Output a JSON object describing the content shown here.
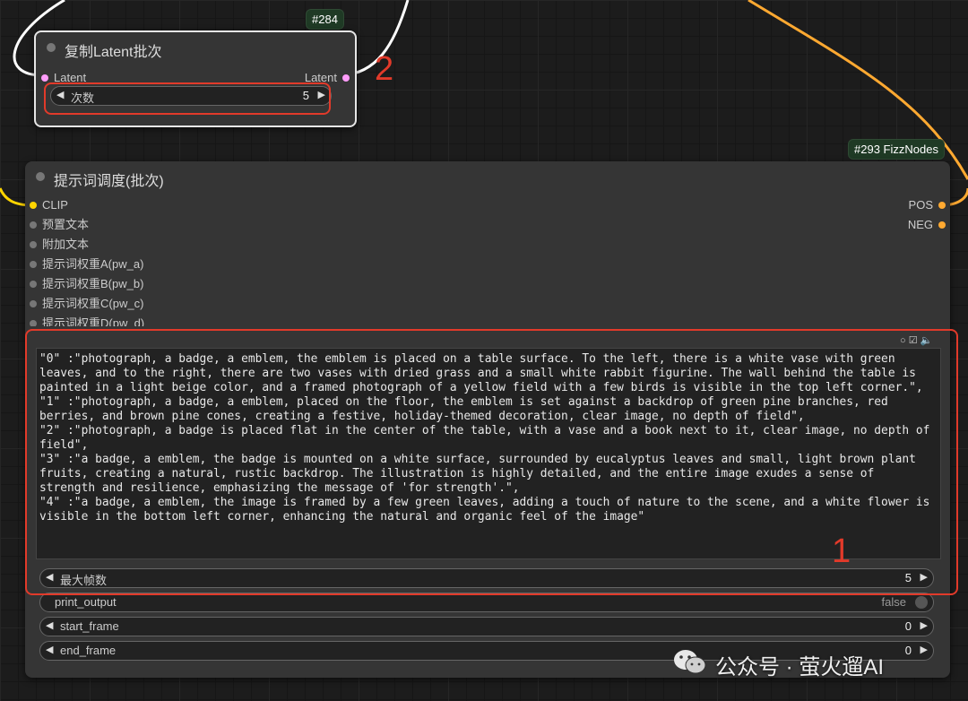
{
  "colors": {
    "annotation": "#e23a2a",
    "latent_pin": "#ff9cf9",
    "clip_pin": "#ffd500",
    "conditioning_pin": "#ffa931",
    "wire_orange": "#ffa931",
    "node_bg": "#353535",
    "badge_bg": "#1f3a25"
  },
  "node_latent": {
    "id": "#284",
    "title": "复制Latent批次",
    "input_label": "Latent",
    "output_label": "Latent",
    "widget": {
      "label": "次数",
      "value": "5"
    }
  },
  "node_prompt": {
    "id": "#293 FizzNodes",
    "title": "提示词调度(批次)",
    "inputs": [
      "CLIP",
      "预置文本",
      "附加文本",
      "提示词权重A(pw_a)",
      "提示词权重B(pw_b)",
      "提示词权重C(pw_c)",
      "提示词权重D(pw_d)"
    ],
    "outputs": [
      "POS",
      "NEG"
    ],
    "text": "\"0\" :\"photograph, a badge, a emblem, the emblem is placed on a table surface. To the left, there is a white vase with green leaves, and to the right, there are two vases with dried grass and a small white rabbit figurine. The wall behind the table is painted in a light beige color, and a framed photograph of a yellow field with a few birds is visible in the top left corner.\",\n\"1\" :\"photograph, a badge, a emblem, placed on the floor, the emblem is set against a backdrop of green pine branches, red berries, and brown pine cones, creating a festive, holiday-themed decoration, clear image, no depth of field\",\n\"2\" :\"photograph, a badge is placed flat in the center of the table, with a vase and a book next to it, clear image, no depth of field\",\n\"3\" :\"a badge, a emblem, the badge is mounted on a white surface, surrounded by eucalyptus leaves and small, light brown plant fruits, creating a natural, rustic backdrop. The illustration is highly detailed, and the entire image exudes a sense of strength and resilience, emphasizing the message of 'for strength'.\",\n\"4\" :\"a badge, a emblem, the image is framed by a few green leaves, adding a touch of nature to the scene, and a white flower is visible in the bottom left corner, enhancing the natural and organic feel of the image\"",
    "widgets": {
      "max_frames": {
        "label": "最大帧数",
        "value": "5"
      },
      "print_output": {
        "label": "print_output",
        "value": "false"
      },
      "start_frame": {
        "label": "start_frame",
        "value": "0"
      },
      "end_frame": {
        "label": "end_frame",
        "value": "0"
      }
    }
  },
  "annotations": {
    "one": "1",
    "two": "2"
  },
  "watermark": "公众号 · 萤火遛AI"
}
